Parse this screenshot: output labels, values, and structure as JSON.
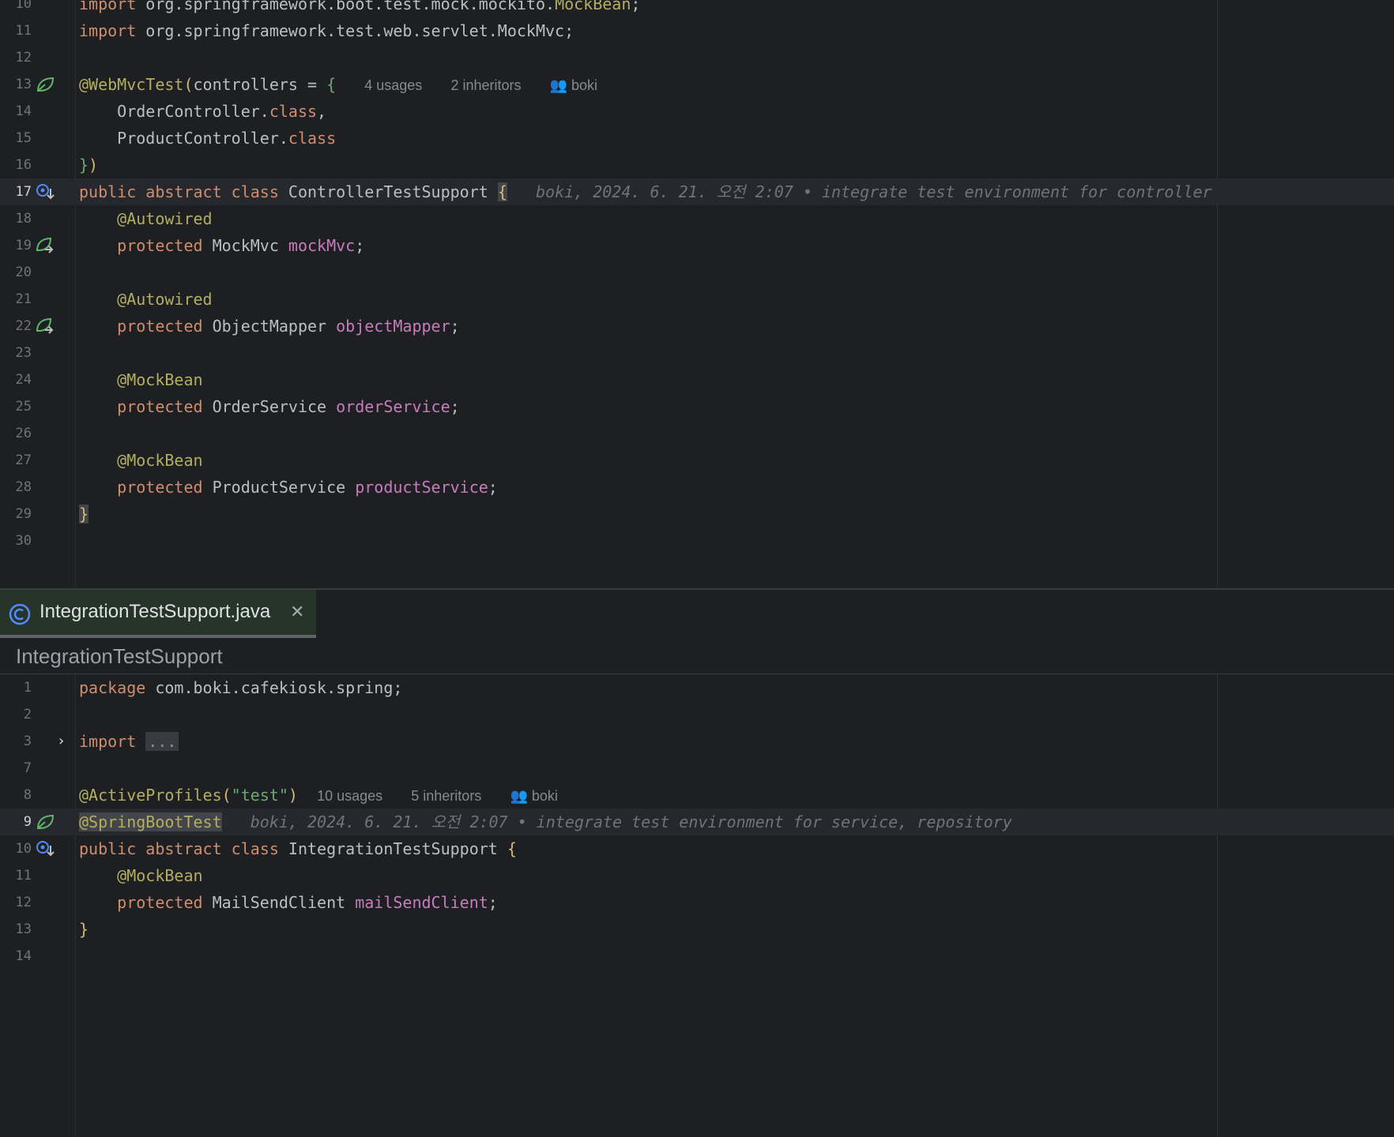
{
  "top_editor": {
    "lines": [
      {
        "n": "10",
        "tokens": [
          {
            "t": "import",
            "c": "kw"
          },
          {
            "t": " org.springframework.boot.test.mock.mockito."
          },
          {
            "t": "MockBean",
            "c": "ann"
          },
          {
            "t": ";"
          }
        ]
      },
      {
        "n": "11",
        "tokens": [
          {
            "t": "import",
            "c": "kw"
          },
          {
            "t": " org.springframework.test.web.servlet.MockMvc;"
          }
        ]
      },
      {
        "n": "12",
        "tokens": []
      },
      {
        "n": "13",
        "icon": "spring-bean-icon",
        "tokens": [
          {
            "t": "@WebMvcTest",
            "c": "ann"
          },
          {
            "t": "(",
            "c": "br1"
          },
          {
            "t": "controllers = "
          },
          {
            "t": "{",
            "c": "brg"
          },
          {
            "t": "   "
          },
          {
            "t": "4 usages",
            "c": "inlay"
          },
          {
            "t": "   "
          },
          {
            "t": "2 inheritors",
            "c": "inlay"
          },
          {
            "t": "   "
          },
          {
            "t": "👥 boki",
            "c": "inlay"
          }
        ]
      },
      {
        "n": "14",
        "tokens": [
          {
            "t": "    OrderController."
          },
          {
            "t": "class",
            "c": "kw"
          },
          {
            "t": ","
          }
        ]
      },
      {
        "n": "15",
        "tokens": [
          {
            "t": "    ProductController."
          },
          {
            "t": "class",
            "c": "kw"
          }
        ]
      },
      {
        "n": "16",
        "tokens": [
          {
            "t": "}",
            "c": "brg"
          },
          {
            "t": ")",
            "c": "br1"
          }
        ]
      },
      {
        "n": "17",
        "current": true,
        "icon": "implemented-by-icon",
        "tokens": [
          {
            "t": "public abstract class",
            "c": "kw"
          },
          {
            "t": " ControllerTestSupport "
          },
          {
            "t": "{",
            "c": "br1 hl-br"
          },
          {
            "t": "   "
          },
          {
            "t": "boki, 2024. 6. 21. 오전 2:07 • integrate test environment for controller",
            "c": "blame"
          }
        ]
      },
      {
        "n": "18",
        "tokens": [
          {
            "t": "    "
          },
          {
            "t": "@Autowired",
            "c": "ann"
          }
        ]
      },
      {
        "n": "19",
        "icon": "autowired-bean-icon",
        "tokens": [
          {
            "t": "    "
          },
          {
            "t": "protected",
            "c": "kw"
          },
          {
            "t": " MockMvc "
          },
          {
            "t": "mockMvc",
            "c": "fld"
          },
          {
            "t": ";"
          }
        ]
      },
      {
        "n": "20",
        "tokens": []
      },
      {
        "n": "21",
        "tokens": [
          {
            "t": "    "
          },
          {
            "t": "@Autowired",
            "c": "ann"
          }
        ]
      },
      {
        "n": "22",
        "icon": "autowired-bean-icon",
        "tokens": [
          {
            "t": "    "
          },
          {
            "t": "protected",
            "c": "kw"
          },
          {
            "t": " ObjectMapper "
          },
          {
            "t": "objectMapper",
            "c": "fld"
          },
          {
            "t": ";"
          }
        ]
      },
      {
        "n": "23",
        "tokens": []
      },
      {
        "n": "24",
        "tokens": [
          {
            "t": "    "
          },
          {
            "t": "@MockBean",
            "c": "ann"
          }
        ]
      },
      {
        "n": "25",
        "tokens": [
          {
            "t": "    "
          },
          {
            "t": "protected",
            "c": "kw"
          },
          {
            "t": " OrderService "
          },
          {
            "t": "orderService",
            "c": "fld"
          },
          {
            "t": ";"
          }
        ]
      },
      {
        "n": "26",
        "tokens": []
      },
      {
        "n": "27",
        "tokens": [
          {
            "t": "    "
          },
          {
            "t": "@MockBean",
            "c": "ann"
          }
        ]
      },
      {
        "n": "28",
        "tokens": [
          {
            "t": "    "
          },
          {
            "t": "protected",
            "c": "kw"
          },
          {
            "t": " ProductService "
          },
          {
            "t": "productService",
            "c": "fld"
          },
          {
            "t": ";"
          }
        ]
      },
      {
        "n": "29",
        "tokens": [
          {
            "t": "}",
            "c": "br1 hl-br"
          }
        ]
      },
      {
        "n": "30",
        "tokens": []
      }
    ]
  },
  "tab": {
    "label": "IntegrationTestSupport.java",
    "close": "✕"
  },
  "breadcrumb": "IntegrationTestSupport",
  "bottom_editor": {
    "lines": [
      {
        "n": "1",
        "tokens": [
          {
            "t": "package",
            "c": "kw"
          },
          {
            "t": " com.boki.cafekiosk.spring;"
          }
        ]
      },
      {
        "n": "2",
        "tokens": []
      },
      {
        "n": "3",
        "fold": true,
        "tokens": [
          {
            "t": "import",
            "c": "kw"
          },
          {
            "t": " "
          },
          {
            "t": "...",
            "c": "folded"
          }
        ]
      },
      {
        "n": "7",
        "tokens": []
      },
      {
        "n": "8",
        "tokens": [
          {
            "t": "@ActiveProfiles",
            "c": "ann"
          },
          {
            "t": "(",
            "c": "br1"
          },
          {
            "t": "\"test\"",
            "c": "str"
          },
          {
            "t": ")",
            "c": "br1"
          },
          {
            "t": "  "
          },
          {
            "t": "10 usages",
            "c": "inlay"
          },
          {
            "t": "   "
          },
          {
            "t": "5 inheritors",
            "c": "inlay"
          },
          {
            "t": "   "
          },
          {
            "t": "👥 boki",
            "c": "inlay"
          }
        ]
      },
      {
        "n": "9",
        "current": true,
        "icon": "spring-bean-icon",
        "tokens": [
          {
            "t": "@SpringBootTest",
            "c": "ann hl-br"
          },
          {
            "t": "   "
          },
          {
            "t": "boki, 2024. 6. 21. 오전 2:07 • integrate test environment for service, repository",
            "c": "blame"
          }
        ]
      },
      {
        "n": "10",
        "icon": "implemented-by-icon",
        "tokens": [
          {
            "t": "public abstract class",
            "c": "kw"
          },
          {
            "t": " IntegrationTestSupport "
          },
          {
            "t": "{",
            "c": "br1"
          }
        ]
      },
      {
        "n": "11",
        "tokens": [
          {
            "t": "    "
          },
          {
            "t": "@MockBean",
            "c": "ann"
          }
        ]
      },
      {
        "n": "12",
        "tokens": [
          {
            "t": "    "
          },
          {
            "t": "protected",
            "c": "kw"
          },
          {
            "t": " MailSendClient "
          },
          {
            "t": "mailSendClient",
            "c": "fld"
          },
          {
            "t": ";"
          }
        ]
      },
      {
        "n": "13",
        "tokens": [
          {
            "t": "}",
            "c": "br1"
          }
        ]
      },
      {
        "n": "14",
        "tokens": []
      }
    ]
  },
  "colors": {
    "background": "#1e1f22",
    "keyword": "#cf8e6d",
    "annotation": "#b3ae60",
    "field": "#c77dbb",
    "string": "#6aab73",
    "comment_blame": "#6f737a"
  }
}
